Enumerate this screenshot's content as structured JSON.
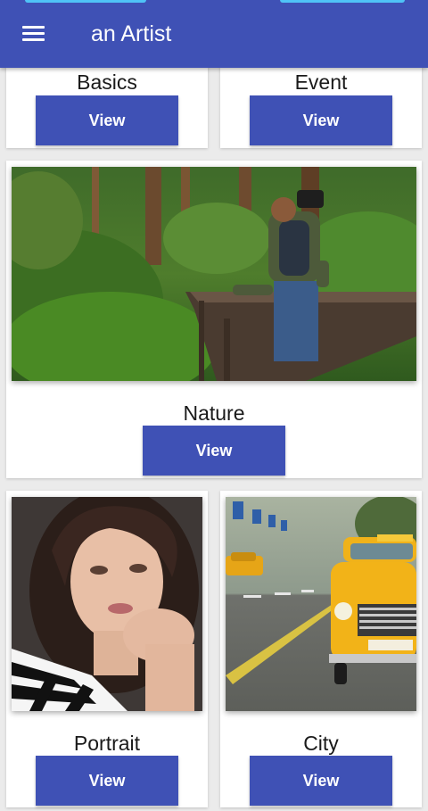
{
  "app_bar": {
    "title": "an Artist",
    "menu_icon": "hamburger-menu-icon",
    "background_color": "#3f51b5"
  },
  "categories": [
    {
      "title": "Basics",
      "button_label": "View"
    },
    {
      "title": "Event",
      "button_label": "View"
    },
    {
      "title": "Nature",
      "button_label": "View",
      "image": "forest-photographer-image"
    },
    {
      "title": "Portrait",
      "button_label": "View",
      "image": "woman-portrait-image"
    },
    {
      "title": "City",
      "button_label": "View",
      "image": "yellow-taxi-street-image"
    }
  ],
  "colors": {
    "primary": "#3f51b5",
    "card_background": "#ffffff",
    "page_background": "#ebebeb"
  }
}
